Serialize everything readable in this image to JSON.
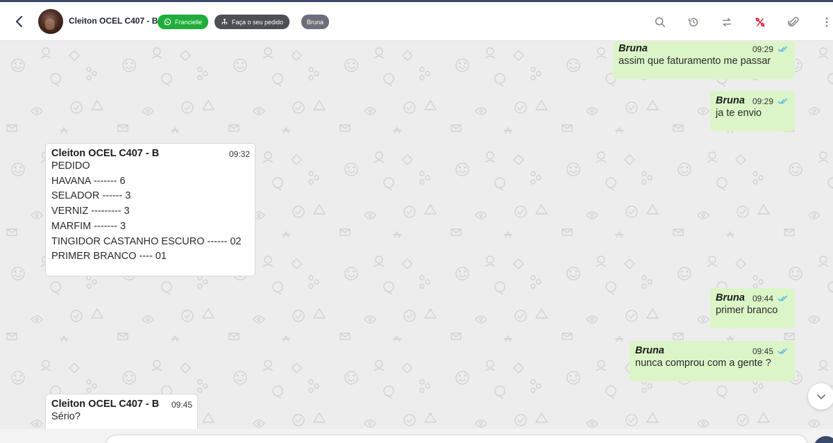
{
  "header": {
    "contact_name": "Cleiton OCEL C407 - B",
    "tags": [
      {
        "label": "Francielle",
        "color": "#1fae3b",
        "icon": "whatsapp-icon"
      },
      {
        "label": "Faça o seu pedido",
        "color": "#4c4f55",
        "icon": "flow-icon"
      },
      {
        "label": "Bruna",
        "color": "#6b7078"
      }
    ],
    "icons": [
      "search-icon",
      "history-icon",
      "transfer-icon",
      "percent-off-icon",
      "attach-icon",
      "more-vert-icon"
    ]
  },
  "messages": [
    {
      "direction": "out",
      "sender": "Bruna",
      "time": "09:29",
      "lines": [
        "assim que faturamento me passar"
      ],
      "read": true
    },
    {
      "direction": "out",
      "sender": "Bruna",
      "time": "09:29",
      "lines": [
        "ja te envio"
      ],
      "read": true
    },
    {
      "direction": "in",
      "sender": "Cleiton OCEL C407 - B",
      "time": "09:32",
      "lines": [
        "PEDIDO",
        "HAVANA ------- 6",
        "SELADOR ------ 3",
        "VERNIZ --------- 3",
        "MARFIM ------- 3",
        "TINGIDOR CASTANHO ESCURO ------ 02",
        "PRIMER BRANCO ---- 01"
      ]
    },
    {
      "direction": "out",
      "sender": "Bruna",
      "time": "09:44",
      "lines": [
        "primer branco"
      ],
      "read": true
    },
    {
      "direction": "out",
      "sender": "Bruna",
      "time": "09:45",
      "lines": [
        "nunca comprou com a gente ?"
      ],
      "read": true
    },
    {
      "direction": "in",
      "sender": "Cleiton OCEL C407 - B",
      "time": "09:45",
      "lines": [
        "Sério?"
      ]
    }
  ],
  "colors": {
    "outgoing_bubble": "#dcf5c8",
    "incoming_bubble": "#ffffff",
    "read_ticks": "#4fb6e8",
    "accent": "#3b4a6b"
  }
}
